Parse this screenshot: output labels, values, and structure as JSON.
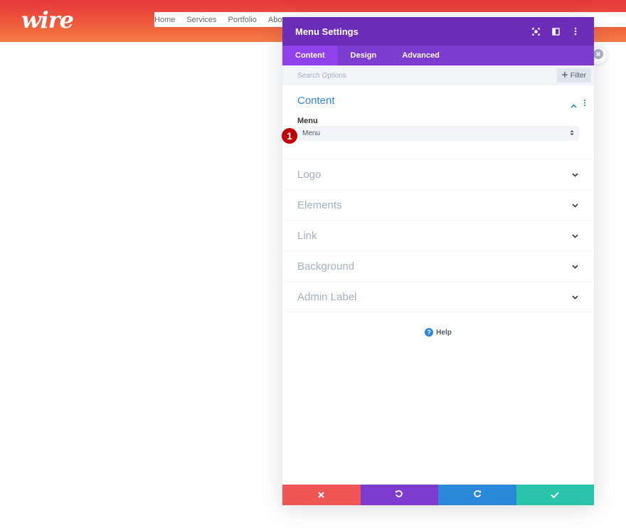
{
  "site": {
    "logo_text": "wire",
    "nav": [
      "Home",
      "Services",
      "Portfolio",
      "About"
    ]
  },
  "modal": {
    "title": "Menu Settings",
    "tabs": [
      {
        "label": "Content",
        "active": true
      },
      {
        "label": "Design",
        "active": false
      },
      {
        "label": "Advanced",
        "active": false
      }
    ],
    "search_placeholder": "Search Options",
    "filter_label": "Filter",
    "content_section": {
      "title": "Content",
      "field_label": "Menu",
      "select_value": "Menu"
    },
    "step_badge": "1",
    "sections": [
      "Logo",
      "Elements",
      "Link",
      "Background",
      "Admin Label"
    ],
    "help_label": "Help"
  },
  "colors": {
    "header_purple": "#6c2eb9",
    "tab_purple": "#7e3bd0",
    "active_tab": "#8f42ec",
    "accent_blue": "#2b87da",
    "cancel_red": "#ef5555",
    "undo_purple": "#7e3bd0",
    "redo_blue": "#2b87da",
    "save_green": "#29c4a9"
  },
  "icons": [
    "fullscreen-icon",
    "split-view-icon",
    "kebab-menu-icon",
    "plus-icon",
    "chevron-up-icon",
    "chevron-down-icon",
    "help-icon",
    "cancel-icon",
    "undo-icon",
    "redo-icon",
    "check-icon",
    "close-icon"
  ]
}
